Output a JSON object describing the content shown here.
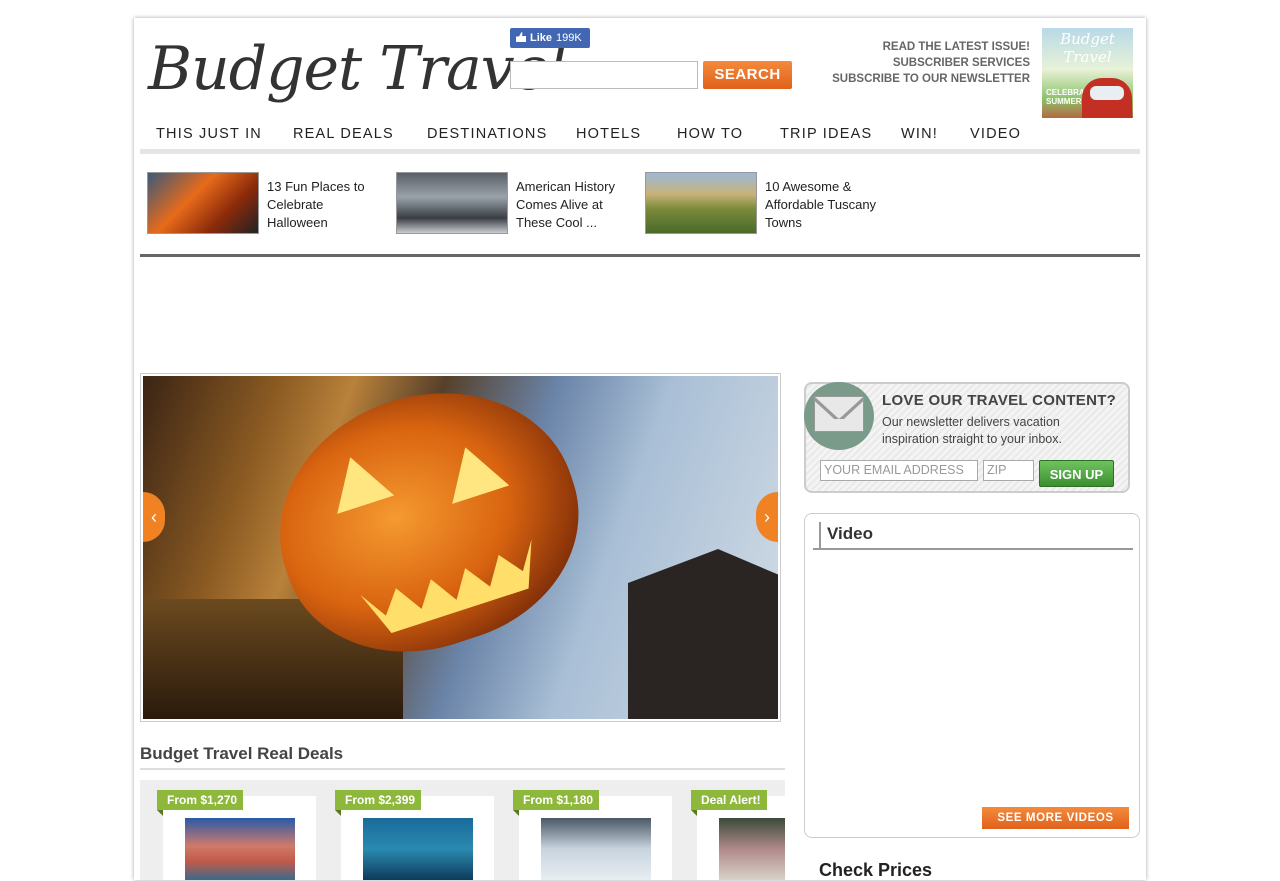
{
  "header": {
    "logo_text": "Budget Travel",
    "fb_like": {
      "label": "Like",
      "count": "199K"
    },
    "search": {
      "button_label": "SEARCH",
      "value": ""
    },
    "top_links": [
      "READ THE LATEST ISSUE!",
      "SUBSCRIBER SERVICES",
      "SUBSCRIBE TO OUR NEWSLETTER"
    ],
    "magazine": {
      "title": "Budget Travel",
      "cover_line": "CELEBRATE SUMMER!"
    }
  },
  "nav": {
    "items": [
      "THIS JUST IN",
      "REAL DEALS",
      "DESTINATIONS",
      "HOTELS",
      "HOW TO",
      "TRIP IDEAS",
      "WIN!",
      "VIDEO"
    ]
  },
  "featured": [
    {
      "title": "13 Fun Places to Celebrate Halloween"
    },
    {
      "title": "American History Comes Alive at These Cool ..."
    },
    {
      "title": "10 Awesome & Affordable Tuscany Towns"
    }
  ],
  "slideshow": {
    "prev": "‹",
    "next": "›"
  },
  "real_deals": {
    "heading": "Budget Travel Real Deals",
    "deals": [
      {
        "tag": "From $1,270"
      },
      {
        "tag": "From $2,399"
      },
      {
        "tag": "From $1,180"
      },
      {
        "tag": "Deal Alert!"
      }
    ]
  },
  "newsletter": {
    "title": "LOVE OUR TRAVEL CONTENT?",
    "subtitle": "Our newsletter delivers vacation inspiration straight to your inbox.",
    "email_placeholder": "YOUR EMAIL ADDRESS",
    "zip_placeholder": "ZIP",
    "button_label": "SIGN UP"
  },
  "video": {
    "title": "Video",
    "more_label": "SEE MORE VIDEOS"
  },
  "check_prices": {
    "title": "Check Prices"
  }
}
